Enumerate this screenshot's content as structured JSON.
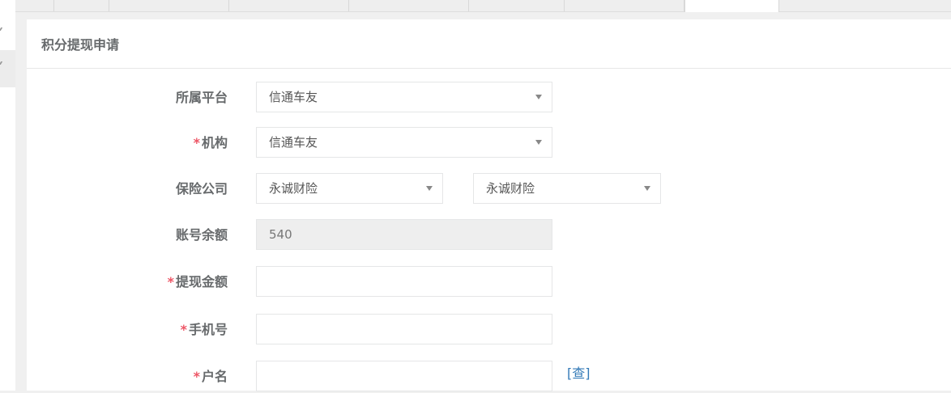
{
  "panel": {
    "title": "积分提现申请"
  },
  "form": {
    "platform": {
      "label": "所属平台",
      "required": false,
      "value": "信通车友"
    },
    "org": {
      "label": "机构",
      "required": true,
      "value": "信通车友"
    },
    "insurer": {
      "label": "保险公司",
      "required": false,
      "value1": "永诚财险",
      "value2": "永诚财险"
    },
    "balance": {
      "label": "账号余额",
      "required": false,
      "value": "540"
    },
    "amount": {
      "label": "提现金额",
      "required": true,
      "value": ""
    },
    "phone": {
      "label": "手机号",
      "required": true,
      "value": ""
    },
    "account_name": {
      "label": "户名",
      "required": true,
      "value": "",
      "lookup_link": "[查]"
    }
  },
  "required_mark": "*",
  "colors": {
    "required": "#ed5565",
    "link": "#337ab7",
    "label": "#676a6c"
  }
}
